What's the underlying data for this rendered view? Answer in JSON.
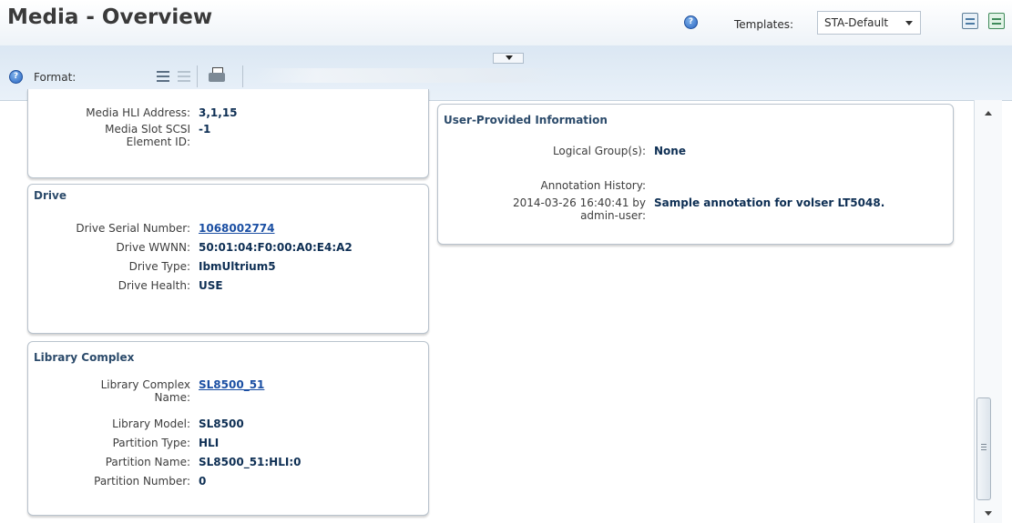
{
  "header": {
    "title": "Media - Overview",
    "templates_label": "Templates:",
    "template_selected": "STA-Default"
  },
  "toolbar": {
    "format_label": "Format:"
  },
  "media_panel": {
    "rows": [
      {
        "label": "Media HLI Address:",
        "value": "3,1,15"
      },
      {
        "label": "Media Slot SCSI Element ID:",
        "value": "-1"
      }
    ]
  },
  "drive_panel": {
    "title": "Drive",
    "rows": [
      {
        "label": "Drive Serial Number:",
        "value": "1068002774"
      },
      {
        "label": "Drive WWNN:",
        "value": "50:01:04:F0:00:A0:E4:A2"
      },
      {
        "label": "Drive Type:",
        "value": "IbmUltrium5"
      },
      {
        "label": "Drive Health:",
        "value": "USE"
      }
    ]
  },
  "library_panel": {
    "title": "Library Complex",
    "rows": [
      {
        "label": "Library Complex Name:",
        "value": "SL8500_51"
      },
      {
        "label": "Library Model:",
        "value": "SL8500"
      },
      {
        "label": "Partition Type:",
        "value": "HLI"
      },
      {
        "label": "Partition Name:",
        "value": "SL8500_51:HLI:0"
      },
      {
        "label": "Partition Number:",
        "value": "0"
      }
    ]
  },
  "user_panel": {
    "title": "User-Provided Information",
    "logical_group_label": "Logical Group(s):",
    "logical_group_value": "None",
    "annotation_history_label": "Annotation History:",
    "annotation_meta": "2014-03-26 16:40:41 by admin-user:",
    "annotation_text": "Sample annotation for volser LT5048."
  },
  "colors": {
    "link": "#1b4fa3",
    "value_text": "#0e2f54",
    "panel_title": "#2c4b6b"
  }
}
